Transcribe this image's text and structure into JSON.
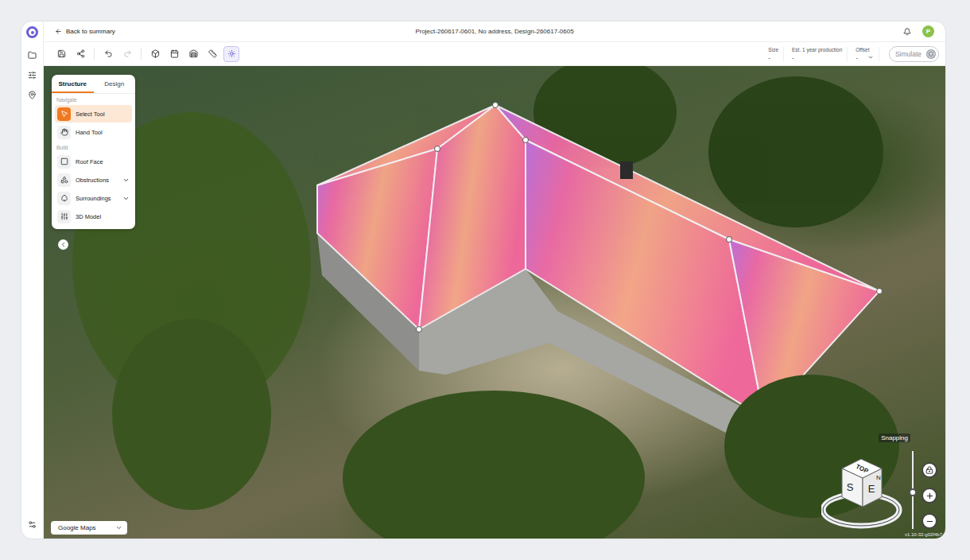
{
  "header": {
    "back": "Back to summary",
    "title": "Project-260617-0601, No address, Design-260617-0605",
    "avatar": "P"
  },
  "toolbar": {
    "tools": [
      {
        "selected": false,
        "disabled": false
      },
      {
        "selected": false,
        "disabled": false
      },
      {
        "selected": false,
        "disabled": false
      },
      {
        "selected": false,
        "disabled": true
      },
      {
        "selected": false,
        "disabled": false
      },
      {
        "selected": false,
        "disabled": false
      },
      {
        "selected": false,
        "disabled": false
      },
      {
        "selected": false,
        "disabled": false
      },
      {
        "selected": true,
        "disabled": false
      }
    ],
    "stats": [
      {
        "label": "Size",
        "value": "-",
        "dropdown": false
      },
      {
        "label": "Est. 1 year production",
        "value": "-",
        "dropdown": false
      },
      {
        "label": "Offset",
        "value": "-",
        "dropdown": true
      }
    ],
    "simulate": {
      "label": "Simulate",
      "disabled": true
    }
  },
  "panel": {
    "tabs": [
      {
        "label": "Structure",
        "selected": true
      },
      {
        "label": "Design",
        "selected": false
      }
    ],
    "sections": [
      {
        "title": "Navigate",
        "items": [
          {
            "label": "Select Tool",
            "selected": true,
            "expandable": false
          },
          {
            "label": "Hand Tool",
            "selected": false,
            "expandable": false
          }
        ]
      },
      {
        "title": "Build",
        "items": [
          {
            "label": "Roof Face",
            "selected": false,
            "expandable": false
          },
          {
            "label": "Obstructions",
            "selected": false,
            "expandable": true
          },
          {
            "label": "Surroundings",
            "selected": false,
            "expandable": true
          },
          {
            "label": "3D Model",
            "selected": false,
            "expandable": false
          }
        ]
      }
    ]
  },
  "map_source": "Google Maps",
  "compass": {
    "top": "TOP",
    "left": "S",
    "front": "E",
    "right": "N"
  },
  "snapping": {
    "label": "Snapping",
    "locked": true
  },
  "zoom": {
    "level": 0.47
  },
  "version": "v1.10-32-g02f4b7"
}
